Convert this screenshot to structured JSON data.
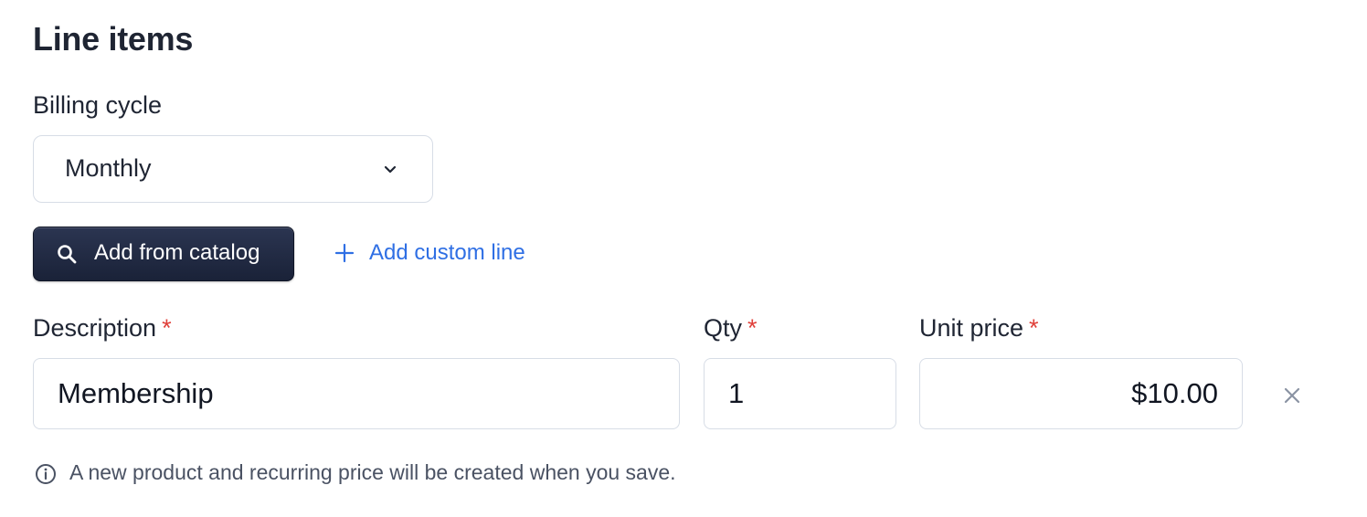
{
  "section": {
    "title": "Line items"
  },
  "billing": {
    "label": "Billing cycle",
    "selected": "Monthly"
  },
  "actions": {
    "add_from_catalog": "Add from catalog",
    "add_custom_line": "Add custom line"
  },
  "line_item": {
    "description_label": "Description",
    "qty_label": "Qty",
    "unit_price_label": "Unit price",
    "required_marker": "*",
    "description_value": "Membership",
    "qty_value": "1",
    "unit_price_value": "$10.00"
  },
  "note": {
    "text": "A new product and recurring price will be created when you save."
  },
  "colors": {
    "primary_button": "#1f2740",
    "link": "#2f6fe4",
    "required": "#e0403a",
    "border": "#d7dde6"
  },
  "icons": {
    "select_chevron": "chevron-down-icon",
    "catalog_button": "search-icon",
    "custom_line": "plus-icon",
    "remove_line": "close-icon",
    "note": "info-icon"
  }
}
